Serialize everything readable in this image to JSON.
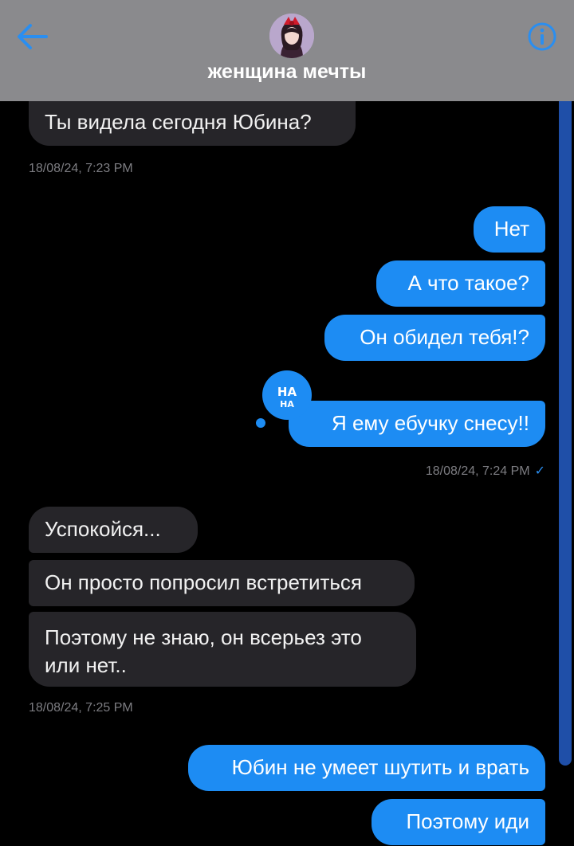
{
  "header": {
    "title": "женщина мечты",
    "back_icon": "arrow-left-icon",
    "info_icon": "info-icon",
    "accent_color": "#2a8ef0",
    "background": "#8a8a8d"
  },
  "colors": {
    "incoming_bubble": "#262529",
    "outgoing_bubble": "#1d8cf3",
    "timestamp": "#7d7d82",
    "background": "#000000"
  },
  "messages": [
    {
      "dir": "in",
      "text": "Ты видела сегодня Юбина?"
    },
    {
      "dir": "out",
      "text": "Нет"
    },
    {
      "dir": "out",
      "text": "А что такое?"
    },
    {
      "dir": "out",
      "text": "Он обидел тебя!?"
    },
    {
      "dir": "out",
      "text": "Я ему ебучку снесу!!"
    },
    {
      "dir": "in",
      "text": "Успокойся..."
    },
    {
      "dir": "in",
      "text": "Он просто попросил встретиться"
    },
    {
      "dir": "in",
      "text": "Поэтому не знаю, он всерьез это или нет.."
    },
    {
      "dir": "out",
      "text": "Юбин не умеет шутить и врать"
    },
    {
      "dir": "out",
      "text": "Поэтому иди"
    }
  ],
  "timestamps": [
    "18/08/24, 7:23 PM",
    "18/08/24, 7:24 PM",
    "18/08/24, 7:25 PM"
  ],
  "sticker": {
    "text_top": "НА",
    "text_bottom": "НА",
    "icon": "sticker-badge-icon"
  },
  "read_receipt_icon": "checkmark-icon"
}
